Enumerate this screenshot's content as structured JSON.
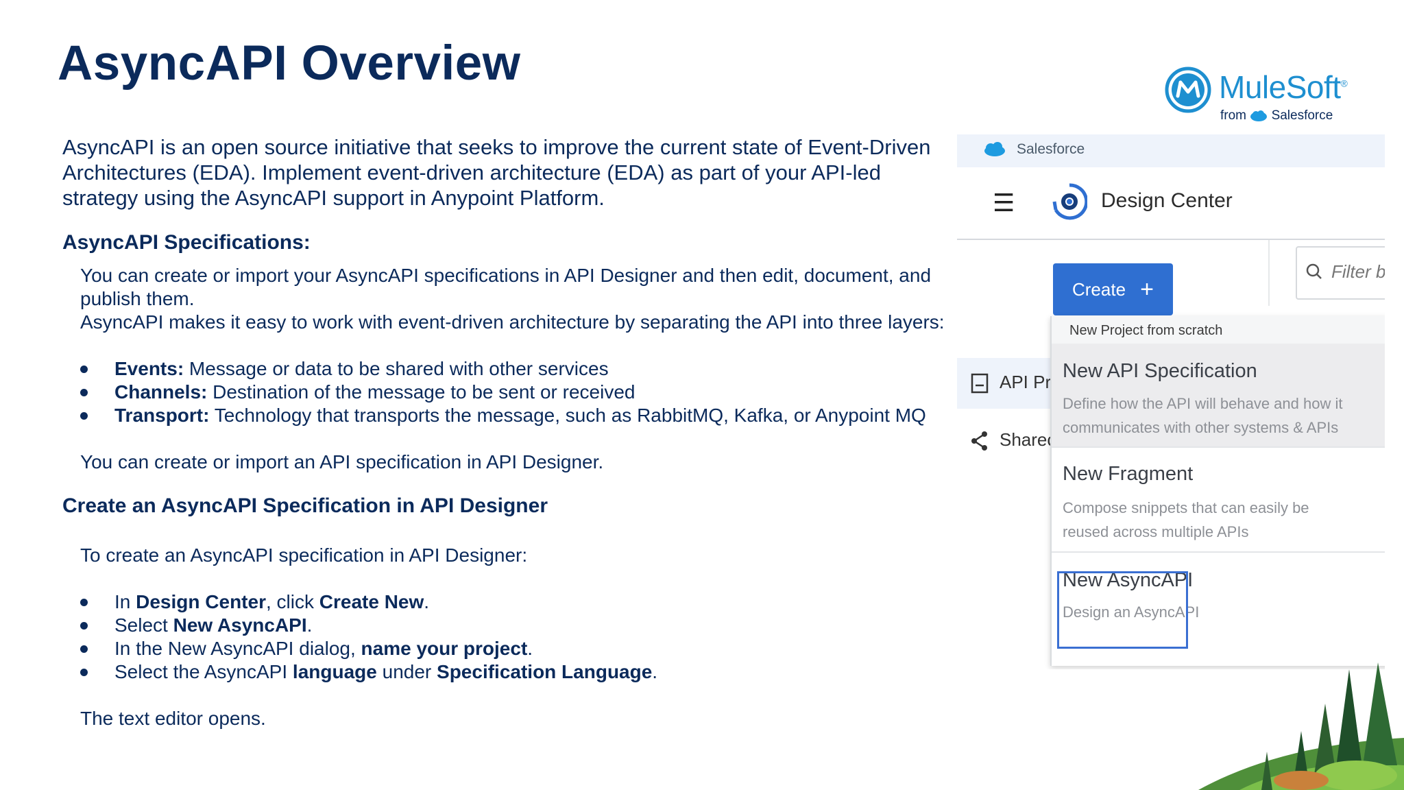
{
  "slide": {
    "title": "AsyncAPI Overview",
    "intro": "AsyncAPI is an open source initiative that seeks to improve the current state of Event-Driven Architectures (EDA). Implement event-driven architecture (EDA) as part of your API-led strategy using the AsyncAPI support in Anypoint Platform.",
    "specs_heading": "AsyncAPI Specifications:",
    "specs_p1": "You can create or import your AsyncAPI specifications in API Designer and then edit, document, and publish them.",
    "specs_p2": "AsyncAPI makes it easy to work with event-driven architecture by separating the API into three layers:",
    "layers": [
      {
        "term": "Events:",
        "text": " Message or data to be shared with other services"
      },
      {
        "term": "Channels:",
        "text": " Destination of the message to be sent or received"
      },
      {
        "term": "Transport:",
        "text": " Technology that transports the message, such as RabbitMQ, Kafka, or Anypoint MQ"
      }
    ],
    "specs_p3": "You can create or import an API specification in API Designer.",
    "create_heading": "Create an AsyncAPI Specification in API Designer",
    "create_intro": "To create an AsyncAPI specification in API Designer:",
    "steps": [
      {
        "a": "In ",
        "b1": "Design Center",
        "c": ", click ",
        "b2": "Create New",
        "d": "."
      },
      {
        "a": "Select ",
        "b1": "New AsyncAPI",
        "c": ".",
        "b2": "",
        "d": ""
      },
      {
        "a": "In the New AsyncAPI dialog, ",
        "b1": "name your project",
        "c": ".",
        "b2": "",
        "d": ""
      },
      {
        "a": "Select the AsyncAPI ",
        "b1": "language",
        "c": " under ",
        "b2": "Specification Language",
        "d": "."
      }
    ],
    "closing": "The text editor opens."
  },
  "logo": {
    "brand": "MuleSoft",
    "tm": "®",
    "from": "from",
    "parent": "Salesforce",
    "brand_color": "#1e8fd0"
  },
  "ui": {
    "top_bar_label": "Salesforce",
    "header_title": "Design Center",
    "create_button": "Create",
    "create_plus": "+",
    "filter_placeholder": "Filter b",
    "sidebar": {
      "api_projects": "API Pro",
      "shared": "Sharec"
    },
    "dropdown": {
      "header": "New Project from scratch",
      "items": [
        {
          "title": "New API Specification",
          "desc1": "Define how the API will behave and how it",
          "desc2": "communicates with other systems & APIs"
        },
        {
          "title": "New Fragment",
          "desc1": "Compose snippets that can easily be",
          "desc2": "reused across multiple APIs"
        },
        {
          "title": "New AsyncAPI",
          "desc1": "Design an AsyncAPI",
          "desc2": ""
        }
      ]
    },
    "accent_color": "#2f6fd1"
  }
}
